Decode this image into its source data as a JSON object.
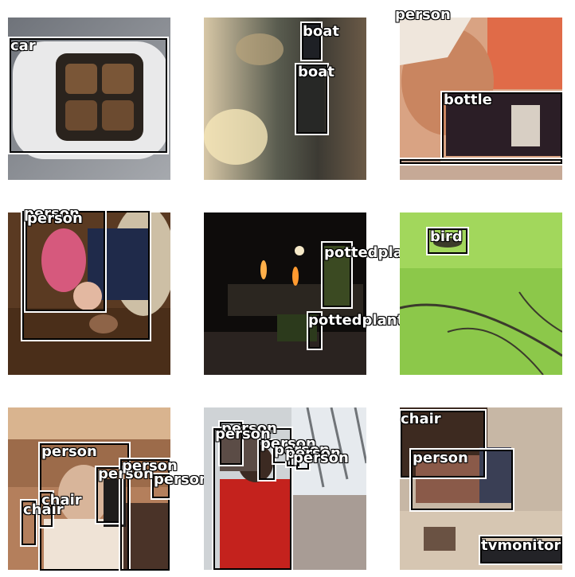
{
  "tiles": [
    {
      "labels": [
        "car"
      ]
    },
    {
      "labels": [
        "boat",
        "boat"
      ]
    },
    {
      "labels": [
        "person",
        "bottle"
      ]
    },
    {
      "labels": [
        "person",
        "person"
      ]
    },
    {
      "labels": [
        "pottedplant",
        "pottedplant"
      ]
    },
    {
      "labels": [
        "bird"
      ]
    },
    {
      "labels": [
        "person",
        "chair",
        "chair",
        "person",
        "person",
        "person"
      ]
    },
    {
      "labels": [
        "person",
        "person",
        "person",
        "person",
        "person",
        "person"
      ]
    },
    {
      "labels": [
        "chair",
        "person",
        "tvmonitor"
      ]
    }
  ]
}
